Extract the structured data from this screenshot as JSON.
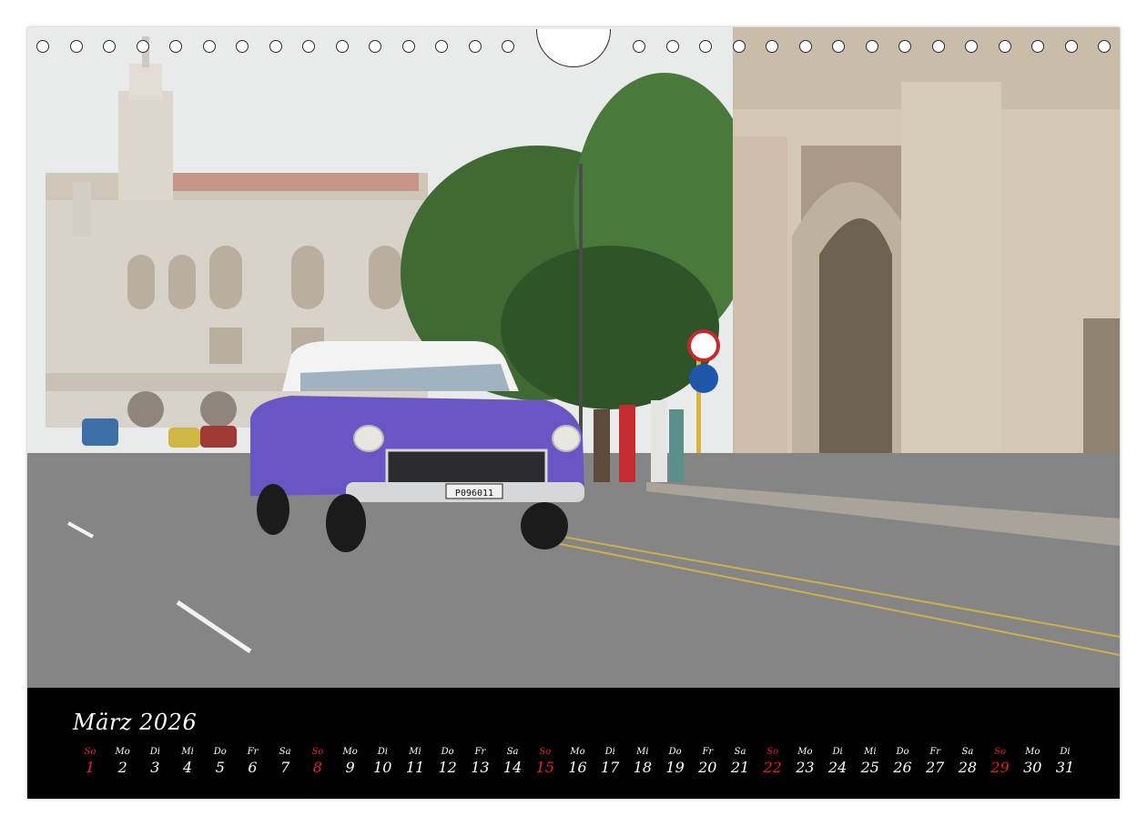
{
  "calendar": {
    "month_title": "März 2026",
    "accent_color": "#e0252b",
    "days": [
      {
        "name": "So",
        "num": "1",
        "sunday": true
      },
      {
        "name": "Mo",
        "num": "2"
      },
      {
        "name": "Di",
        "num": "3"
      },
      {
        "name": "Mi",
        "num": "4"
      },
      {
        "name": "Do",
        "num": "5"
      },
      {
        "name": "Fr",
        "num": "6"
      },
      {
        "name": "Sa",
        "num": "7"
      },
      {
        "name": "So",
        "num": "8",
        "sunday": true
      },
      {
        "name": "Mo",
        "num": "9"
      },
      {
        "name": "Di",
        "num": "10"
      },
      {
        "name": "Mi",
        "num": "11"
      },
      {
        "name": "Do",
        "num": "12"
      },
      {
        "name": "Fr",
        "num": "13"
      },
      {
        "name": "Sa",
        "num": "14"
      },
      {
        "name": "So",
        "num": "15",
        "sunday": true
      },
      {
        "name": "Mo",
        "num": "16"
      },
      {
        "name": "Di",
        "num": "17"
      },
      {
        "name": "Mi",
        "num": "18"
      },
      {
        "name": "Do",
        "num": "19"
      },
      {
        "name": "Fr",
        "num": "20"
      },
      {
        "name": "Sa",
        "num": "21"
      },
      {
        "name": "So",
        "num": "22",
        "sunday": true
      },
      {
        "name": "Mo",
        "num": "23"
      },
      {
        "name": "Di",
        "num": "24"
      },
      {
        "name": "Mi",
        "num": "25"
      },
      {
        "name": "Do",
        "num": "26"
      },
      {
        "name": "Fr",
        "num": "27"
      },
      {
        "name": "Sa",
        "num": "28"
      },
      {
        "name": "So",
        "num": "29",
        "sunday": true
      },
      {
        "name": "Mo",
        "num": "30"
      },
      {
        "name": "Di",
        "num": "31"
      }
    ]
  },
  "photo": {
    "license_plate": "P096011",
    "car_color": "#6a55c4"
  }
}
